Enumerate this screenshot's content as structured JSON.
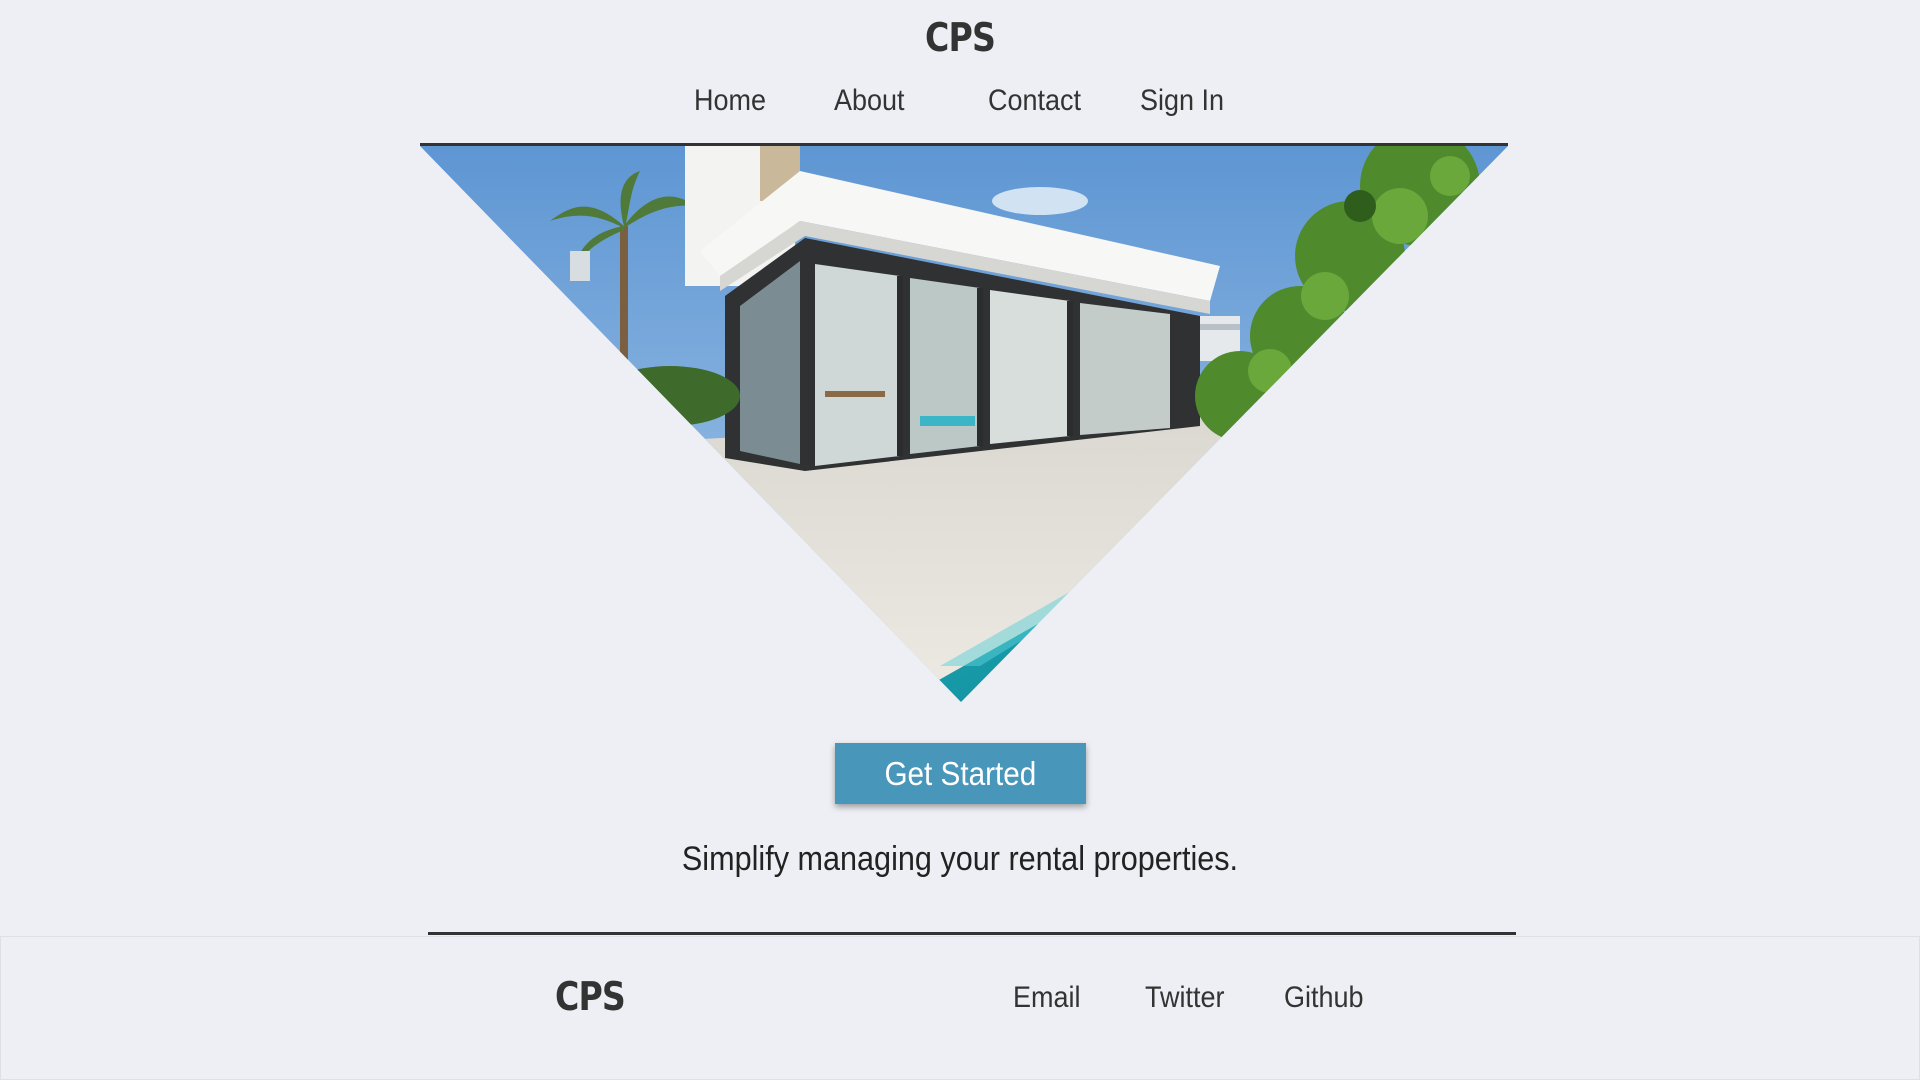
{
  "header": {
    "brand": "CPS",
    "nav": {
      "home": "Home",
      "about": "About",
      "contact": "Contact",
      "sign_in": "Sign In"
    }
  },
  "hero": {
    "image_description": "",
    "cta_label": "Get Started",
    "tagline": "Simplify managing your rental properties."
  },
  "footer": {
    "brand": "CPS",
    "links": {
      "email": "Email",
      "twitter": "Twitter",
      "github": "Github"
    }
  },
  "colors": {
    "background": "#eeeff4",
    "accent": "#4896ba",
    "text": "#333333"
  }
}
